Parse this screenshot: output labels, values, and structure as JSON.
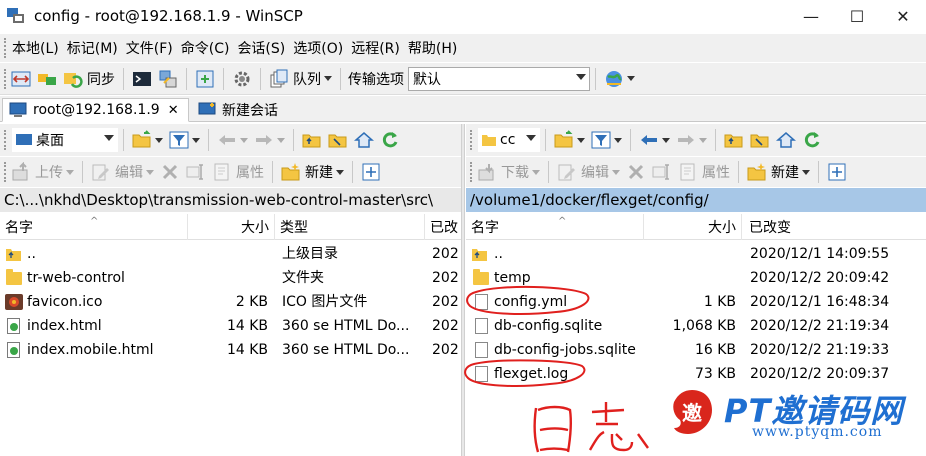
{
  "window": {
    "title": "config - root@192.168.1.9 - WinSCP",
    "minimize": "—",
    "maximize": "☐",
    "close": "✕"
  },
  "menu": [
    "本地(L)",
    "标记(M)",
    "文件(F)",
    "命令(C)",
    "会话(S)",
    "选项(O)",
    "远程(R)",
    "帮助(H)"
  ],
  "toolbar": {
    "sync_label": "同步",
    "queue_label": "队列",
    "transfer_label": "传输选项",
    "transfer_value": "默认"
  },
  "tabs": [
    {
      "label": "root@192.168.1.9",
      "close": "✕"
    },
    {
      "label": "新建会话"
    }
  ],
  "left_panel": {
    "location": "桌面",
    "upload_label": "上传",
    "edit_label": "编辑",
    "props_label": "属性",
    "new_label": "新建",
    "path": "C:\\...\\nkhd\\Desktop\\transmission-web-control-master\\src\\",
    "columns": [
      "名字",
      "大小",
      "类型",
      "已改"
    ],
    "rows": [
      {
        "name": "..",
        "size": "",
        "type": "上级目录",
        "changed": "202"
      },
      {
        "name": "tr-web-control",
        "size": "",
        "type": "文件夹",
        "changed": "202"
      },
      {
        "name": "favicon.ico",
        "size": "2 KB",
        "type": "ICO 图片文件",
        "changed": "202"
      },
      {
        "name": "index.html",
        "size": "14 KB",
        "type": "360 se HTML Do...",
        "changed": "202"
      },
      {
        "name": "index.mobile.html",
        "size": "14 KB",
        "type": "360 se HTML Do...",
        "changed": "202"
      }
    ]
  },
  "right_panel": {
    "location": "cc",
    "download_label": "下载",
    "edit_label": "编辑",
    "props_label": "属性",
    "new_label": "新建",
    "path": "/volume1/docker/flexget/config/",
    "columns": [
      "名字",
      "大小",
      "已改变"
    ],
    "rows": [
      {
        "name": "..",
        "size": "",
        "changed": "2020/12/1 14:09:55"
      },
      {
        "name": "temp",
        "size": "",
        "changed": "2020/12/2 20:09:42"
      },
      {
        "name": "config.yml",
        "size": "1 KB",
        "changed": "2020/12/1 16:48:34"
      },
      {
        "name": "db-config.sqlite",
        "size": "1,068 KB",
        "changed": "2020/12/2 21:19:34"
      },
      {
        "name": "db-config-jobs.sqlite",
        "size": "16 KB",
        "changed": "2020/12/2 21:19:33"
      },
      {
        "name": "flexget.log",
        "size": "73 KB",
        "changed": "2020/12/2 20:09:37"
      }
    ]
  },
  "annotation": {
    "text": "日志",
    "color": "#e0201e"
  },
  "watermark": {
    "brand": "PT邀请码网",
    "url": "www.ptyqm.com",
    "color": "#1f6fd1"
  }
}
